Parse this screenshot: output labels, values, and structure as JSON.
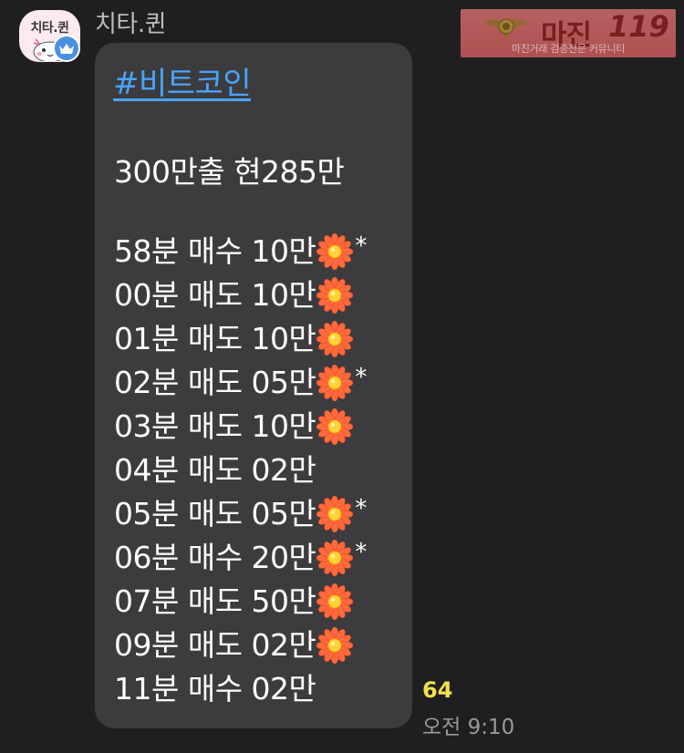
{
  "sender": {
    "name": "치타.퀸",
    "avatar_text": "치타.퀸"
  },
  "watermark": {
    "title": "마진",
    "number": "119",
    "subtitle": "마진거래 검증전문 커뮤니티"
  },
  "message": {
    "hashtag": "#비트코인",
    "summary": "300만출 현285만",
    "lines": [
      {
        "text": "58분 매수 10만",
        "flower": true,
        "star": "*"
      },
      {
        "text": "00분 매도 10만",
        "flower": true,
        "star": ""
      },
      {
        "text": "01분 매도 10만",
        "flower": true,
        "star": ""
      },
      {
        "text": "02분 매도 05만",
        "flower": true,
        "star": "*"
      },
      {
        "text": "03분 매도 10만",
        "flower": true,
        "star": ""
      },
      {
        "text": "04분 매도 02만",
        "flower": false,
        "star": ""
      },
      {
        "text": "05분 매도 05만",
        "flower": true,
        "star": "*"
      },
      {
        "text": "06분 매수 20만",
        "flower": true,
        "star": "*"
      },
      {
        "text": "07분 매도 50만",
        "flower": true,
        "star": ""
      },
      {
        "text": "09분 매도 02만",
        "flower": true,
        "star": ""
      },
      {
        "text": "11분  매수 02만",
        "flower": false,
        "star": ""
      }
    ],
    "read_count": "64",
    "time": "오전 9:10"
  },
  "colors": {
    "background": "#1f1f21",
    "bubble": "#3c3c3e",
    "hashtag": "#4aa3ff",
    "read_count": "#f4e04d",
    "badge": "#4a90e2"
  },
  "icons": {
    "flower": "blossom-emoji-icon",
    "badge": "crown-icon"
  }
}
